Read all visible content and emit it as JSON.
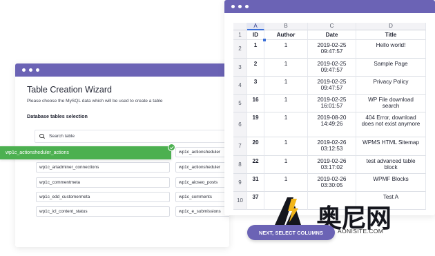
{
  "wizard": {
    "title": "Table Creation Wizard",
    "subtitle": "Please choose the MySQL data which will be used to create a table",
    "section": "Database tables selection",
    "search_placeholder": "Search table",
    "selected_table": "wp1c_actionsheduler_actions",
    "tables_left": [
      "wp1c_ariadminer_connections",
      "wp1c_commentmeta",
      "wp1c_edd_customermeta",
      "wp1c_icl_content_status"
    ],
    "tables_right": [
      "wp1c_actionsheduler",
      "wp1c_actionsheduler",
      "wp1c_aioseo_posts",
      "wp1c_comments",
      "wp1c_e_submissions"
    ]
  },
  "sheet": {
    "col_letters": [
      "A",
      "B",
      "C",
      "D"
    ],
    "rows": [
      {
        "num": "1",
        "cells": [
          "ID",
          "Author",
          "Date",
          "Title"
        ]
      },
      {
        "num": "2",
        "cells": [
          "1",
          "1",
          "2019-02-25 09:47:57",
          "Hello world!"
        ]
      },
      {
        "num": "3",
        "cells": [
          "2",
          "1",
          "2019-02-25 09:47:57",
          "Sample Page"
        ]
      },
      {
        "num": "4",
        "cells": [
          "3",
          "1",
          "2019-02-25 09:47:57",
          "Privacy Policy"
        ]
      },
      {
        "num": "5",
        "cells": [
          "16",
          "1",
          "2019-02-25 16:01:57",
          "WP File download search"
        ]
      },
      {
        "num": "6",
        "cells": [
          "19",
          "1",
          "2019-08-20 14:49:26",
          "404 Error, download does not exist anymore"
        ]
      },
      {
        "num": "7",
        "cells": [
          "20",
          "1",
          "2019-02-26 03:12:53",
          "WPMS HTML Sitemap"
        ]
      },
      {
        "num": "8",
        "cells": [
          "22",
          "1",
          "2019-02-26 03:17:02",
          "test advanced table block"
        ]
      },
      {
        "num": "9",
        "cells": [
          "31",
          "1",
          "2019-02-26 03:30:05",
          "WPMF Blocks"
        ]
      },
      {
        "num": "10",
        "cells": [
          "37",
          "",
          "",
          "Test A"
        ]
      }
    ]
  },
  "next_button": "NEXT, SELECT COLUMNS",
  "watermark": {
    "text": "奥尼网",
    "url": "AONISITE.COM"
  },
  "colors": {
    "titlebar": "#6b63b5",
    "selected_green": "#4cb050",
    "selection_blue": "#3b6fd8"
  }
}
